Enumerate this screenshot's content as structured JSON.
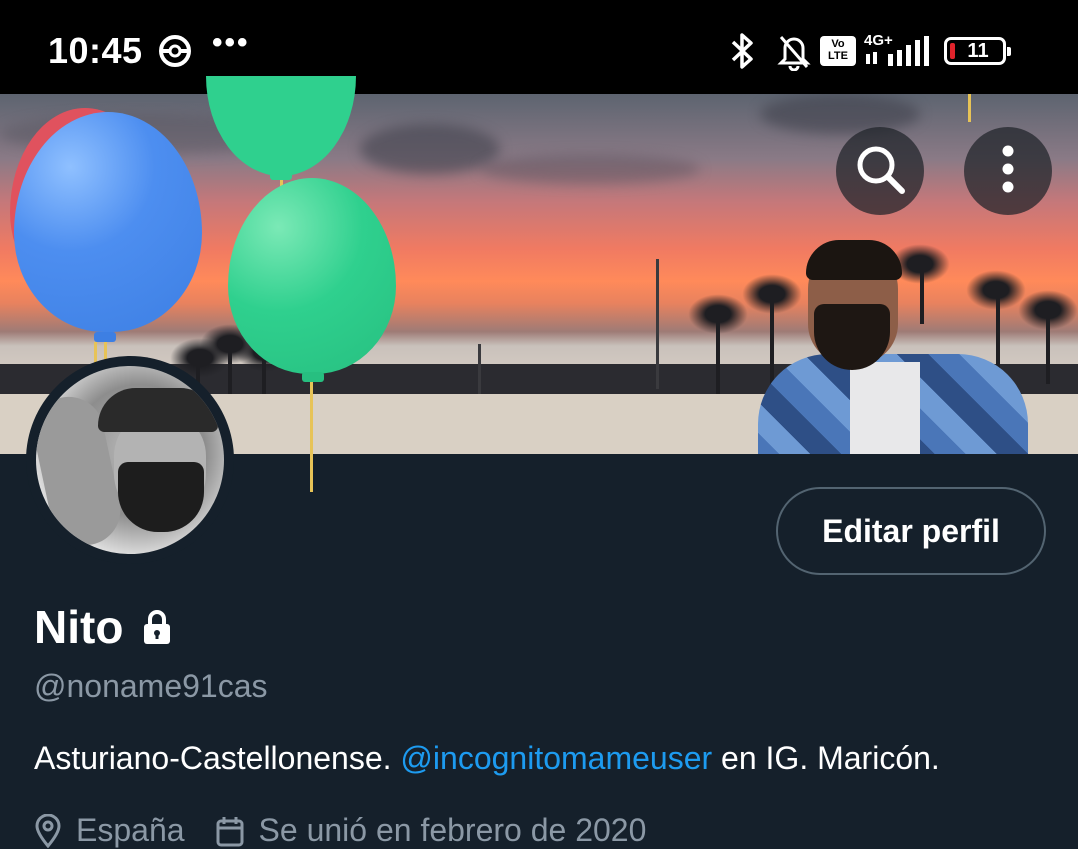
{
  "status_bar": {
    "time": "10:45",
    "dots": "•••",
    "volte_label": "Vo LTE",
    "network": "4G+",
    "battery_level": "11",
    "icons": [
      "pokeball-icon",
      "bluetooth-icon",
      "bell-muted-icon",
      "signal-icon",
      "battery-icon"
    ]
  },
  "header": {
    "search_icon": "search-icon",
    "more_icon": "more-vertical-icon"
  },
  "profile": {
    "edit_button_label": "Editar perfil",
    "display_name": "Nito",
    "protected": true,
    "handle": "@noname91cas",
    "bio_before": "Asturiano-Castellonense. ",
    "bio_mention": "@incognitomameuser",
    "bio_after": " en IG. Maricón.",
    "location": "España",
    "joined": "Se unió en febrero de 2020"
  },
  "colors": {
    "background": "#15202b",
    "mention": "#1d9bf0",
    "secondary_text": "#8b98a5",
    "button_border": "#536471"
  }
}
